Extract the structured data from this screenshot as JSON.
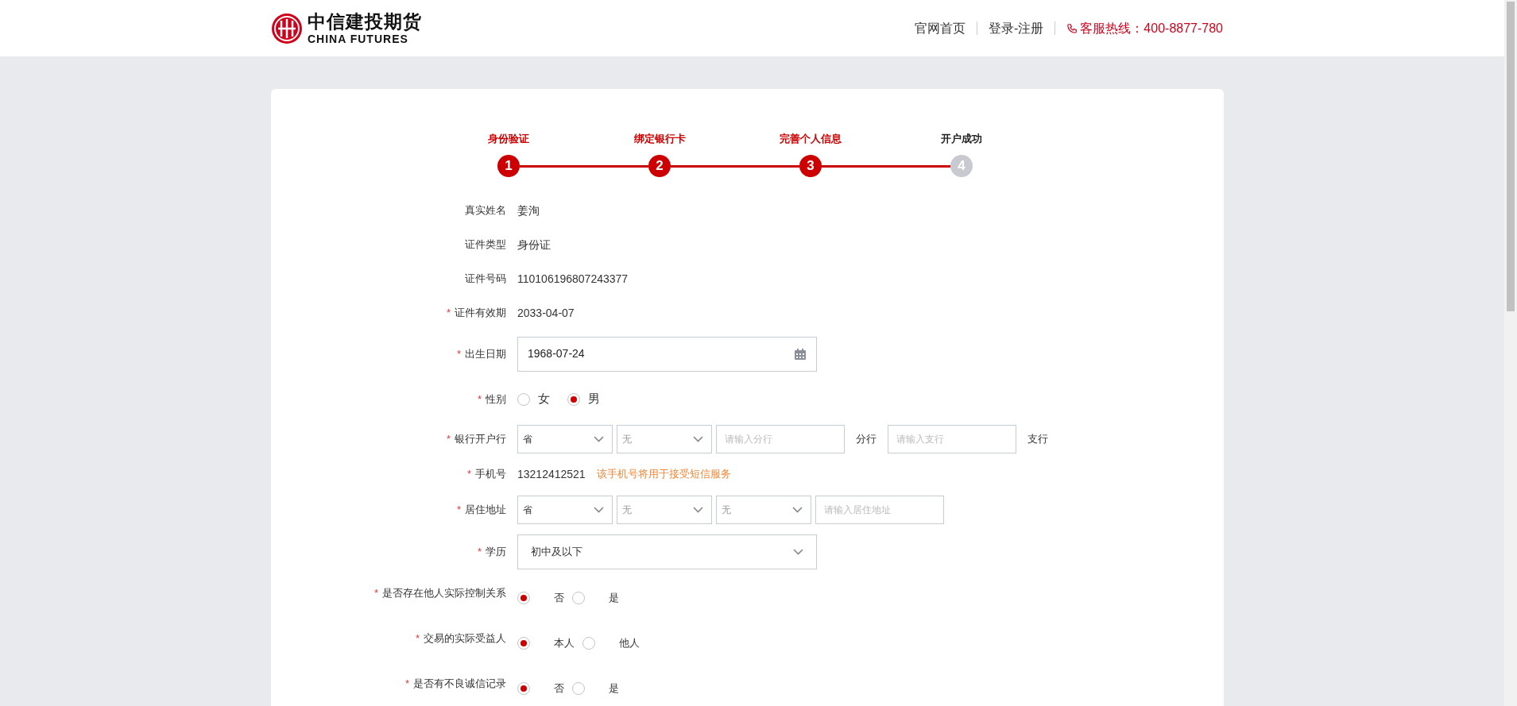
{
  "header": {
    "logo": {
      "name": "中信建投期货",
      "subtitle": "CHINA FUTURES"
    },
    "nav": [
      {
        "label": "官网首页"
      },
      {
        "label": "登录-注册"
      }
    ],
    "hotline": "客服热线：400-8877-780"
  },
  "steps": [
    {
      "label": "身份验证",
      "number": "1",
      "done": true
    },
    {
      "label": "绑定银行卡",
      "number": "2",
      "done": true
    },
    {
      "label": "完善个人信息",
      "number": "3",
      "done": true
    },
    {
      "label": "开户成功",
      "number": "4",
      "done": false
    }
  ],
  "form": [
    {
      "kind": "text",
      "label": "真实姓名",
      "value": "姜洵"
    },
    {
      "kind": "text",
      "label": "证件类型",
      "value": "身份证"
    },
    {
      "kind": "text",
      "label": "证件号码",
      "value": "110106196807243377"
    },
    {
      "kind": "text",
      "marker": "*",
      "label": "证件有效期",
      "value": "2033-04-07"
    },
    {
      "kind": "date",
      "marker": "*",
      "label": "出生日期",
      "value": "1968-07-24"
    },
    {
      "kind": "radio",
      "marker": "*",
      "label": "性别",
      "options": [
        {
          "label": "女",
          "selected": false
        },
        {
          "label": "男",
          "selected": true
        }
      ]
    },
    {
      "kind": "inline",
      "marker": "*",
      "label": "银行开户行",
      "parts": [
        {
          "kind": "select",
          "value": "省",
          "disabled": false
        },
        {
          "kind": "select",
          "value": "无",
          "disabled": true
        },
        {
          "kind": "input",
          "placeholder": "请输入分行"
        },
        {
          "kind": "text",
          "value": "分行"
        },
        {
          "kind": "input",
          "placeholder": "请输入支行"
        },
        {
          "kind": "text",
          "value": "支行"
        }
      ]
    },
    {
      "kind": "text",
      "marker": "*",
      "label": "手机号",
      "value": "13212412521",
      "note": "该手机号将用于接受短信服务"
    },
    {
      "kind": "inline",
      "marker": "*",
      "label": "居住地址",
      "parts": [
        {
          "kind": "select",
          "value": "省",
          "disabled": false
        },
        {
          "kind": "select",
          "value": "无",
          "disabled": true
        },
        {
          "kind": "select",
          "value": "无",
          "disabled": true
        },
        {
          "kind": "input",
          "placeholder": "请输入居住地址"
        }
      ]
    },
    {
      "kind": "select",
      "marker": "*",
      "label": "学历",
      "value": "初中及以下"
    },
    {
      "kind": "choice",
      "marker": "*",
      "label": "是否存在他人实际控制关系",
      "options": [
        {
          "label": "否",
          "selected": true
        },
        {
          "label": "是",
          "selected": false
        }
      ]
    },
    {
      "kind": "choice",
      "marker": "*",
      "label": "交易的实际受益人",
      "options": [
        {
          "label": "本人",
          "selected": true
        },
        {
          "label": "他人",
          "selected": false
        }
      ]
    },
    {
      "kind": "choice",
      "marker": "*",
      "label": "是否有不良诚信记录",
      "options": [
        {
          "label": "否",
          "selected": true
        },
        {
          "label": "是",
          "selected": false
        }
      ]
    }
  ]
}
